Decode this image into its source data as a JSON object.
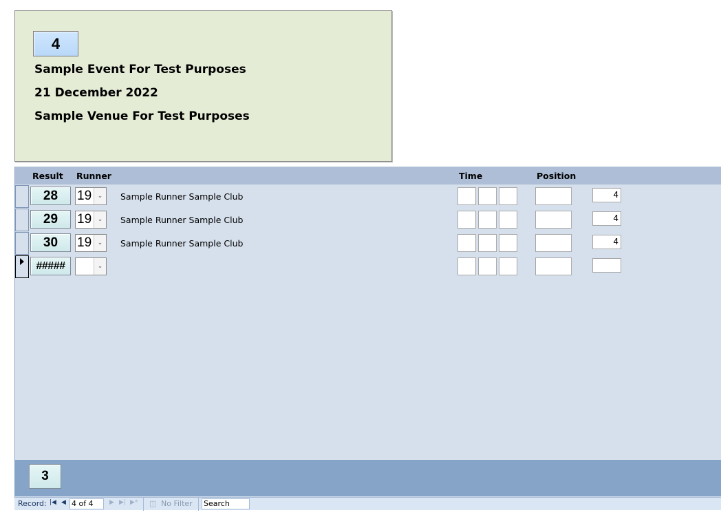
{
  "event": {
    "id": "4",
    "name": "Sample Event For Test Purposes",
    "date": "21 December 2022",
    "venue": "Sample Venue For Test Purposes"
  },
  "columns": {
    "result": "Result",
    "runner": "Runner",
    "time": "Time",
    "position": "Position"
  },
  "rows": [
    {
      "result": "28",
      "runner_id": "19",
      "runner_name": "Sample Runner Sample Club",
      "count": "4"
    },
    {
      "result": "29",
      "runner_id": "19",
      "runner_name": "Sample Runner Sample Club",
      "count": "4"
    },
    {
      "result": "30",
      "runner_id": "19",
      "runner_name": "Sample Runner Sample Club",
      "count": "4"
    },
    {
      "result": "#####",
      "runner_id": "",
      "runner_name": "",
      "count": ""
    }
  ],
  "footer": {
    "value": "3"
  },
  "nav": {
    "record_label": "Record:",
    "record_position": "4 of 4",
    "filter_label": "No Filter",
    "search_label": "Search"
  },
  "icons": {
    "first": "first-record-icon",
    "prev": "previous-record-icon",
    "next": "next-record-icon",
    "last": "last-record-icon",
    "new": "new-record-icon",
    "filter": "filter-icon",
    "combo": "chevron-down-icon",
    "record_pointer": "record-pointer-icon"
  }
}
